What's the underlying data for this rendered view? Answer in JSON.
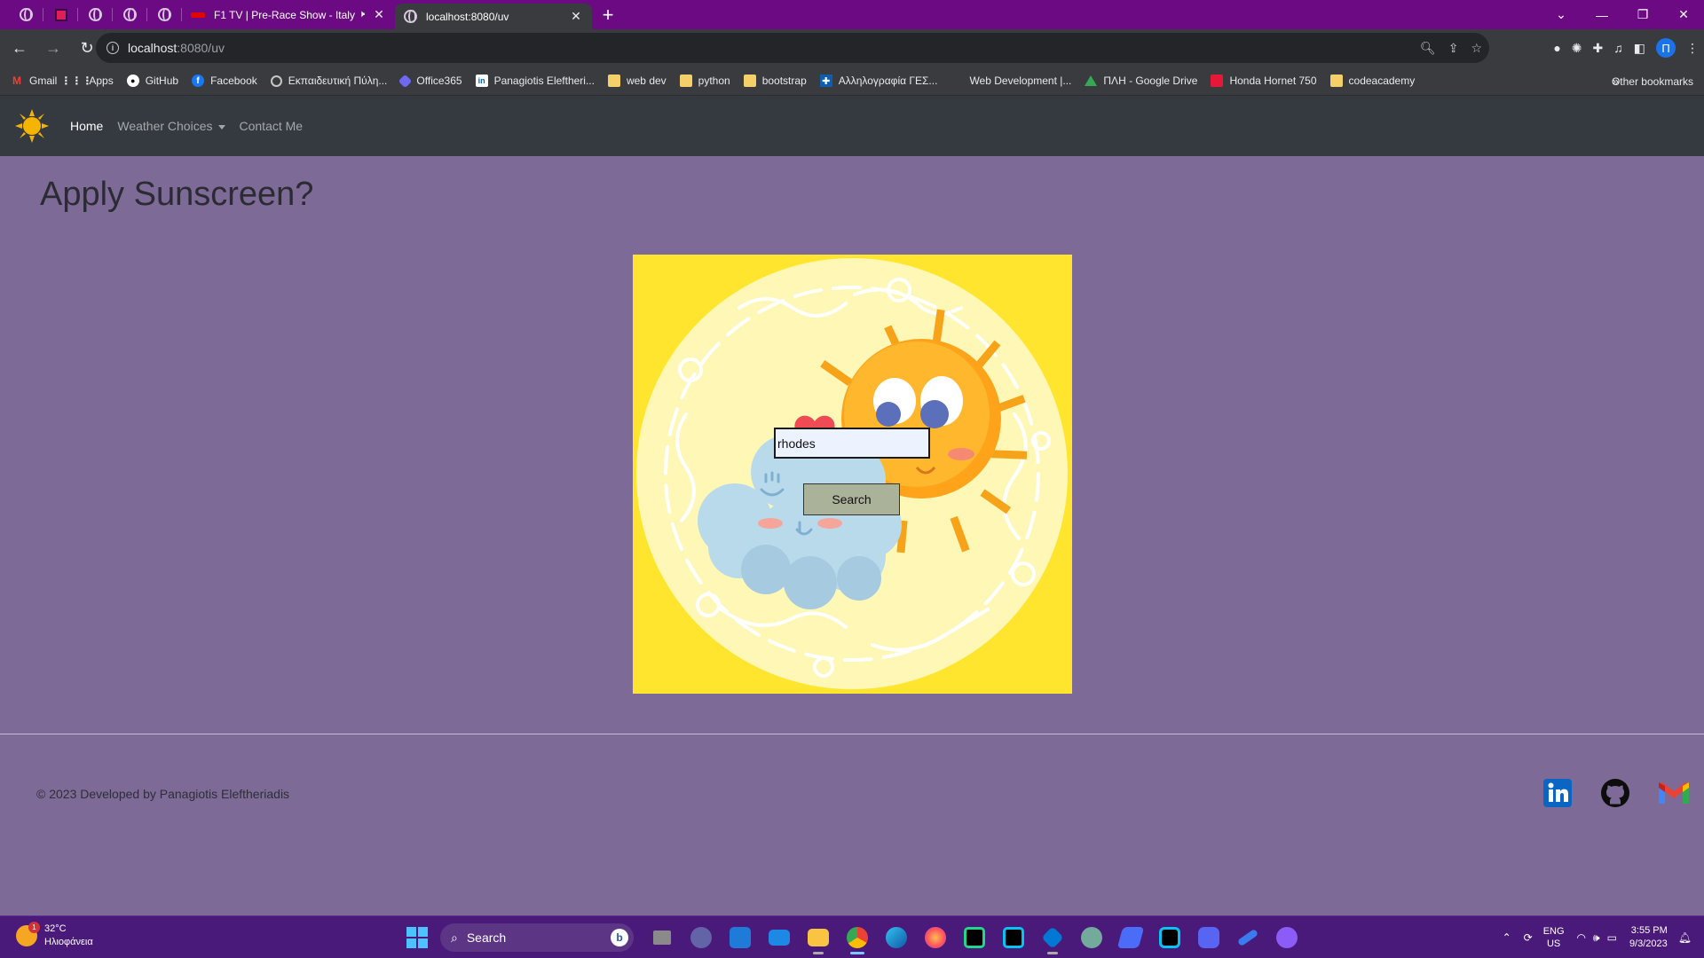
{
  "browser": {
    "tabs": [
      {
        "title": "F1 TV | Pre-Race Show - Italy",
        "muted_icon": "🕨"
      },
      {
        "title": "localhost:8080/uv"
      }
    ],
    "new_tab": "+",
    "url_host": "localhost",
    "url_rest": ":8080/uv",
    "profile_initial": "П",
    "bookmarks": [
      {
        "label": "Gmail",
        "icon": "gmail-icon"
      },
      {
        "label": "Apps",
        "icon": "apps-icon"
      },
      {
        "label": "GitHub",
        "icon": "github-icon"
      },
      {
        "label": "Facebook",
        "icon": "facebook-icon"
      },
      {
        "label": "Εκπαιδευτική Πύλη...",
        "icon": "globe-icon"
      },
      {
        "label": "Office365",
        "icon": "office365-icon"
      },
      {
        "label": "Panagiotis Eleftheri...",
        "icon": "linkedin-icon"
      },
      {
        "label": "web dev",
        "icon": "folder-icon"
      },
      {
        "label": "python",
        "icon": "folder-icon"
      },
      {
        "label": "bootstrap",
        "icon": "folder-icon"
      },
      {
        "label": "Αλληλογραφία ΓΕΣ...",
        "icon": "greek-flag-icon"
      },
      {
        "label": "Web Development |...",
        "icon": "blank-icon"
      },
      {
        "label": "ΠΛΗ - Google Drive",
        "icon": "google-drive-icon"
      },
      {
        "label": "Honda Hornet 750",
        "icon": "honda-icon"
      },
      {
        "label": "codeacademy",
        "icon": "folder-icon"
      }
    ],
    "bookmarks_overflow": "»",
    "other_bookmarks": "Other bookmarks"
  },
  "navbar": {
    "links": {
      "home": "Home",
      "weather_choices": "Weather Choices",
      "contact": "Contact Me"
    }
  },
  "page": {
    "title": "Apply Sunscreen?",
    "search_value": "rhodes",
    "search_button": "Search"
  },
  "footer": {
    "copyright": "© 2023 Developed by Panagiotis Eleftheriadis"
  },
  "taskbar": {
    "weather_temp": "32°C",
    "weather_desc": "Ηλιοφάνεια",
    "weather_badge": "1",
    "search_label": "Search",
    "lang_top": "ENG",
    "lang_bottom": "US",
    "time": "3:55 PM",
    "date": "9/3/2023"
  },
  "colors": {
    "navbar": "#343a40",
    "page_bg": "#7d6a96",
    "tabstrip": "#6b0a83",
    "taskbar": "#4a1a7a",
    "hero_yellow": "#ffe52e"
  }
}
